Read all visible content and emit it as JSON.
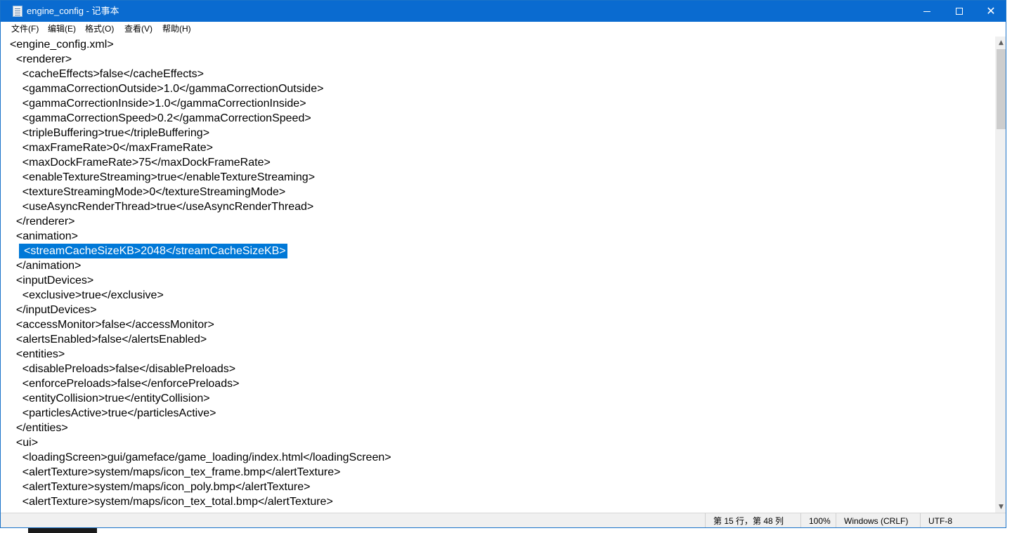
{
  "window": {
    "title": "engine_config - 记事本"
  },
  "menu": [
    "文件(F)",
    "编辑(E)",
    "格式(O)",
    "查看(V)",
    "帮助(H)"
  ],
  "editor": {
    "lines": [
      "<engine_config.xml>",
      "  <renderer>",
      "    <cacheEffects>false</cacheEffects>",
      "    <gammaCorrectionOutside>1.0</gammaCorrectionOutside>",
      "    <gammaCorrectionInside>1.0</gammaCorrectionInside>",
      "    <gammaCorrectionSpeed>0.2</gammaCorrectionSpeed>",
      "    <tripleBuffering>true</tripleBuffering>",
      "    <maxFrameRate>0</maxFrameRate>",
      "    <maxDockFrameRate>75</maxDockFrameRate>",
      "    <enableTextureStreaming>true</enableTextureStreaming>",
      "    <textureStreamingMode>0</textureStreamingMode>",
      "    <useAsyncRenderThread>true</useAsyncRenderThread>",
      "  </renderer>",
      "  <animation>",
      "    <streamCacheSizeKB>2048</streamCacheSizeKB>",
      "  </animation>",
      "  <inputDevices>",
      "    <exclusive>true</exclusive>",
      "  </inputDevices>",
      "  <accessMonitor>false</accessMonitor>",
      "  <alertsEnabled>false</alertsEnabled>",
      "  <entities>",
      "    <disablePreloads>false</disablePreloads>",
      "    <enforcePreloads>false</enforcePreloads>",
      "    <entityCollision>true</entityCollision>",
      "    <particlesActive>true</particlesActive>",
      "  </entities>",
      "  <ui>",
      "    <loadingScreen>gui/gameface/game_loading/index.html</loadingScreen>",
      "    <alertTexture>system/maps/icon_tex_frame.bmp</alertTexture>",
      "    <alertTexture>system/maps/icon_poly.bmp</alertTexture>",
      "    <alertTexture>system/maps/icon_tex_total.bmp</alertTexture>"
    ],
    "selected_line": 15
  },
  "status": {
    "position": "第 15 行，第 48 列",
    "zoom": "100%",
    "line_ending": "Windows (CRLF)",
    "encoding": "UTF-8"
  },
  "colors": {
    "titlebar": "#0a6bd0",
    "selection": "#0078d7"
  }
}
